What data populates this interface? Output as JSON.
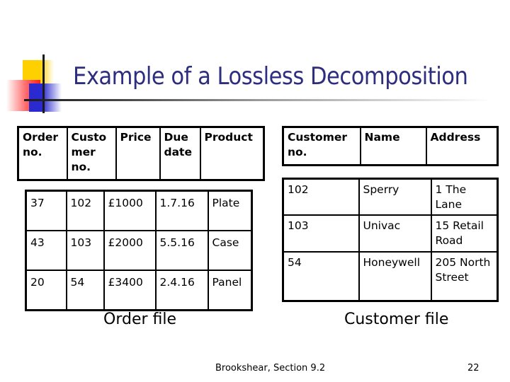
{
  "slide": {
    "title": "Example of a Lossless Decomposition",
    "footer": "Brookshear, Section 9.2",
    "page_number": "22",
    "title_color": "#2e2e80",
    "logo_icon": "four-square-cross-logo"
  },
  "order_table": {
    "headers": [
      "Order no.",
      "Custo mer no.",
      "Price",
      "Due date",
      "Product"
    ],
    "rows": [
      [
        "37",
        "102",
        "£1000",
        "1.7.16",
        "Plate"
      ],
      [
        "43",
        "103",
        "£2000",
        "5.5.16",
        "Case"
      ],
      [
        "20",
        "54",
        "£3400",
        "2.4.16",
        "Panel"
      ]
    ],
    "caption": "Order file"
  },
  "customer_table": {
    "headers": [
      "Customer no.",
      "Name",
      "Address"
    ],
    "rows": [
      [
        "102",
        "Sperry",
        "1 The Lane"
      ],
      [
        "103",
        "Univac",
        "15 Retail Road"
      ],
      [
        "54",
        "Honeywell",
        "205 North Street"
      ]
    ],
    "caption": "Customer file"
  }
}
